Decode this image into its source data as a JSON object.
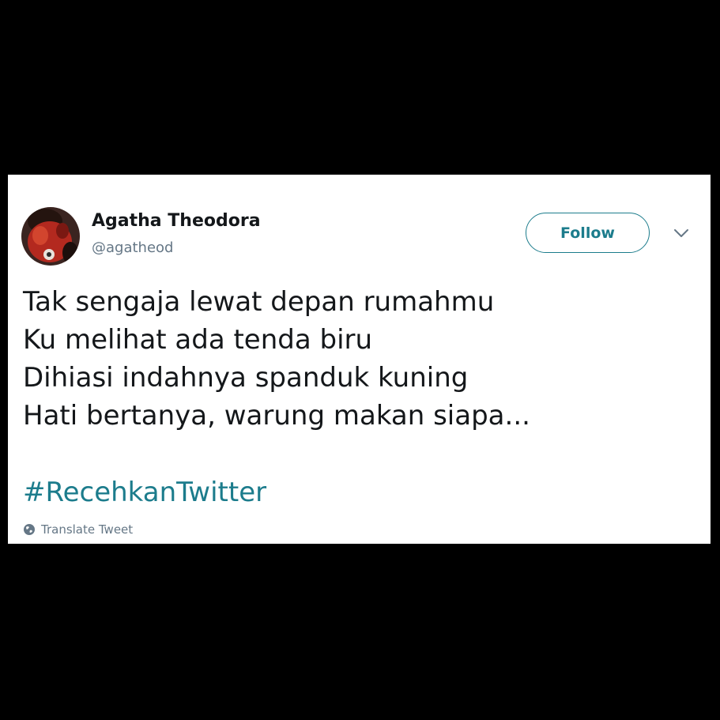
{
  "tweet": {
    "author": {
      "name": "Agatha Theodora",
      "handle": "@agatheod",
      "avatar_icon": "profile-photo"
    },
    "follow_label": "Follow",
    "menu_icon": "chevron-down-icon",
    "lines": [
      "Tak sengaja lewat depan rumahmu",
      "Ku melihat ada tenda biru",
      "Dihiasi indahnya spanduk kuning",
      "Hati bertanya, warung makan siapa..."
    ],
    "hashtag": "#RecehkanTwitter",
    "translate_label": "Translate Tweet",
    "translate_icon": "globe-icon"
  },
  "colors": {
    "background": "#000000",
    "card": "#ffffff",
    "accent": "#1c7c8c",
    "text": "#14171a",
    "muted": "#657786"
  }
}
